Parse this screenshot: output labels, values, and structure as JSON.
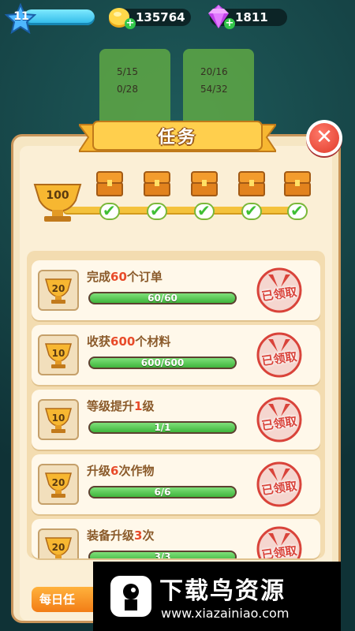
{
  "top_bar": {
    "level": "11",
    "coins": "135764",
    "gems": "1811"
  },
  "bg_cards": [
    {
      "row1": "5/15",
      "row2": "0/28"
    },
    {
      "row1": "20/16",
      "row2": "54/32"
    }
  ],
  "panel": {
    "title": "任务",
    "milestone_points": "100"
  },
  "tasks": [
    {
      "points": "20",
      "name_pre": "完成",
      "name_hl": "60",
      "name_post": "个订单",
      "progress": "60/60",
      "progress_fraction": 1.0,
      "status": "已领取"
    },
    {
      "points": "10",
      "name_pre": "收获",
      "name_hl": "600",
      "name_post": "个材料",
      "progress": "600/600",
      "progress_fraction": 1.0,
      "status": "已领取"
    },
    {
      "points": "10",
      "name_pre": "等级提升",
      "name_hl": "1",
      "name_post": "级",
      "progress": "1/1",
      "progress_fraction": 1.0,
      "status": "已领取"
    },
    {
      "points": "20",
      "name_pre": "升级",
      "name_hl": "6",
      "name_post": "次作物",
      "progress": "6/6",
      "progress_fraction": 1.0,
      "status": "已领取"
    },
    {
      "points": "20",
      "name_pre": "装备升级",
      "name_hl": "3",
      "name_post": "次",
      "progress": "3/3",
      "progress_fraction": 1.0,
      "status": "已领取"
    }
  ],
  "bottom_tab": {
    "label": "每日任"
  },
  "watermark": {
    "title": "下载鸟资源",
    "url": "www.xiazainiao.com"
  },
  "colors": {
    "accent_orange": "#f27d16",
    "progress_green": "#3fb53c",
    "stamp_red": "#d9433a",
    "highlight_red": "#e84b2a"
  }
}
